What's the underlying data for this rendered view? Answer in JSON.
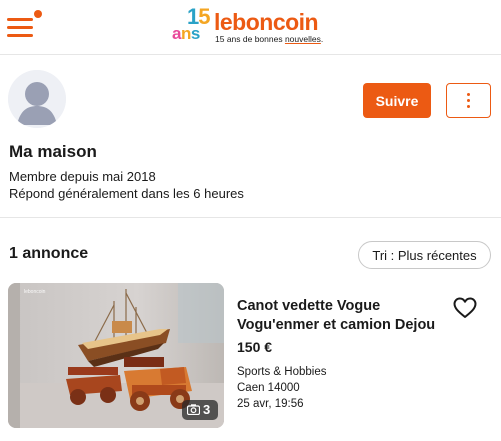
{
  "header": {
    "logo": {
      "num15": "15",
      "ans": "ans",
      "brand": "leboncoin",
      "tagline_prefix": "15 ans de bonnes ",
      "tagline_highlight": "nouvelles",
      "tagline_suffix": "."
    },
    "menu_icon": "hamburger-icon",
    "notification": true
  },
  "profile": {
    "name": "Ma maison",
    "member_since": "Membre depuis mai 2018",
    "response_time": "Répond généralement dans les 6 heures",
    "follow_label": "Suivre",
    "more_icon": "kebab-icon"
  },
  "listings": {
    "count_label": "1 annonce",
    "sort_label": "Tri : Plus récentes",
    "items": [
      {
        "title_line1": "Canot vedette Vogue",
        "title_line2": "Vogu'enmer et camion Dejou",
        "price": "150 €",
        "category": "Sports & Hobbies",
        "location": "Caen 14000",
        "date": "25 avr, 19:56",
        "photo_count": "3",
        "watermark": "leboncoin"
      }
    ]
  },
  "colors": {
    "accent": "#ec5a13",
    "text": "#1a1a1a",
    "divider": "#e6e6e6"
  }
}
